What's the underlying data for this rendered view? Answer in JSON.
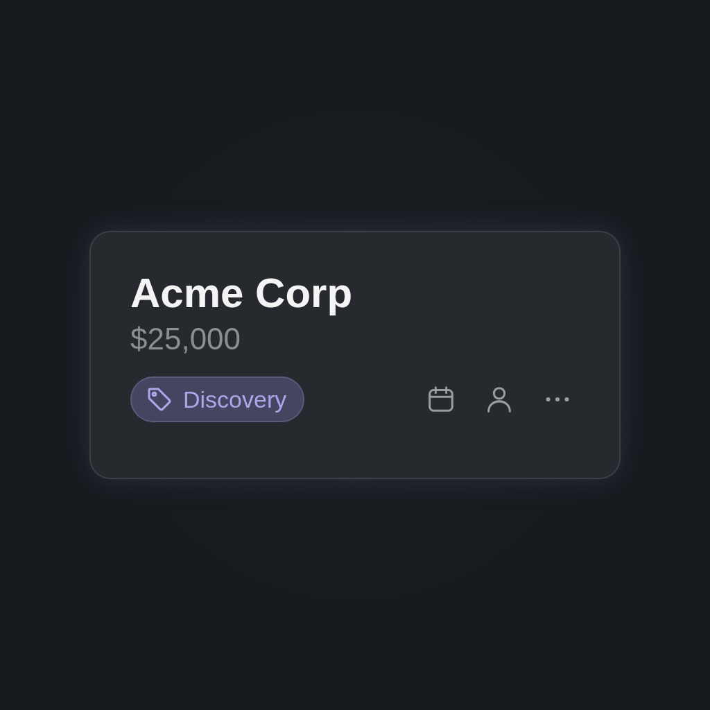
{
  "card": {
    "title": "Acme Corp",
    "amount": "$25,000",
    "tag": {
      "label": "Discovery"
    }
  }
}
